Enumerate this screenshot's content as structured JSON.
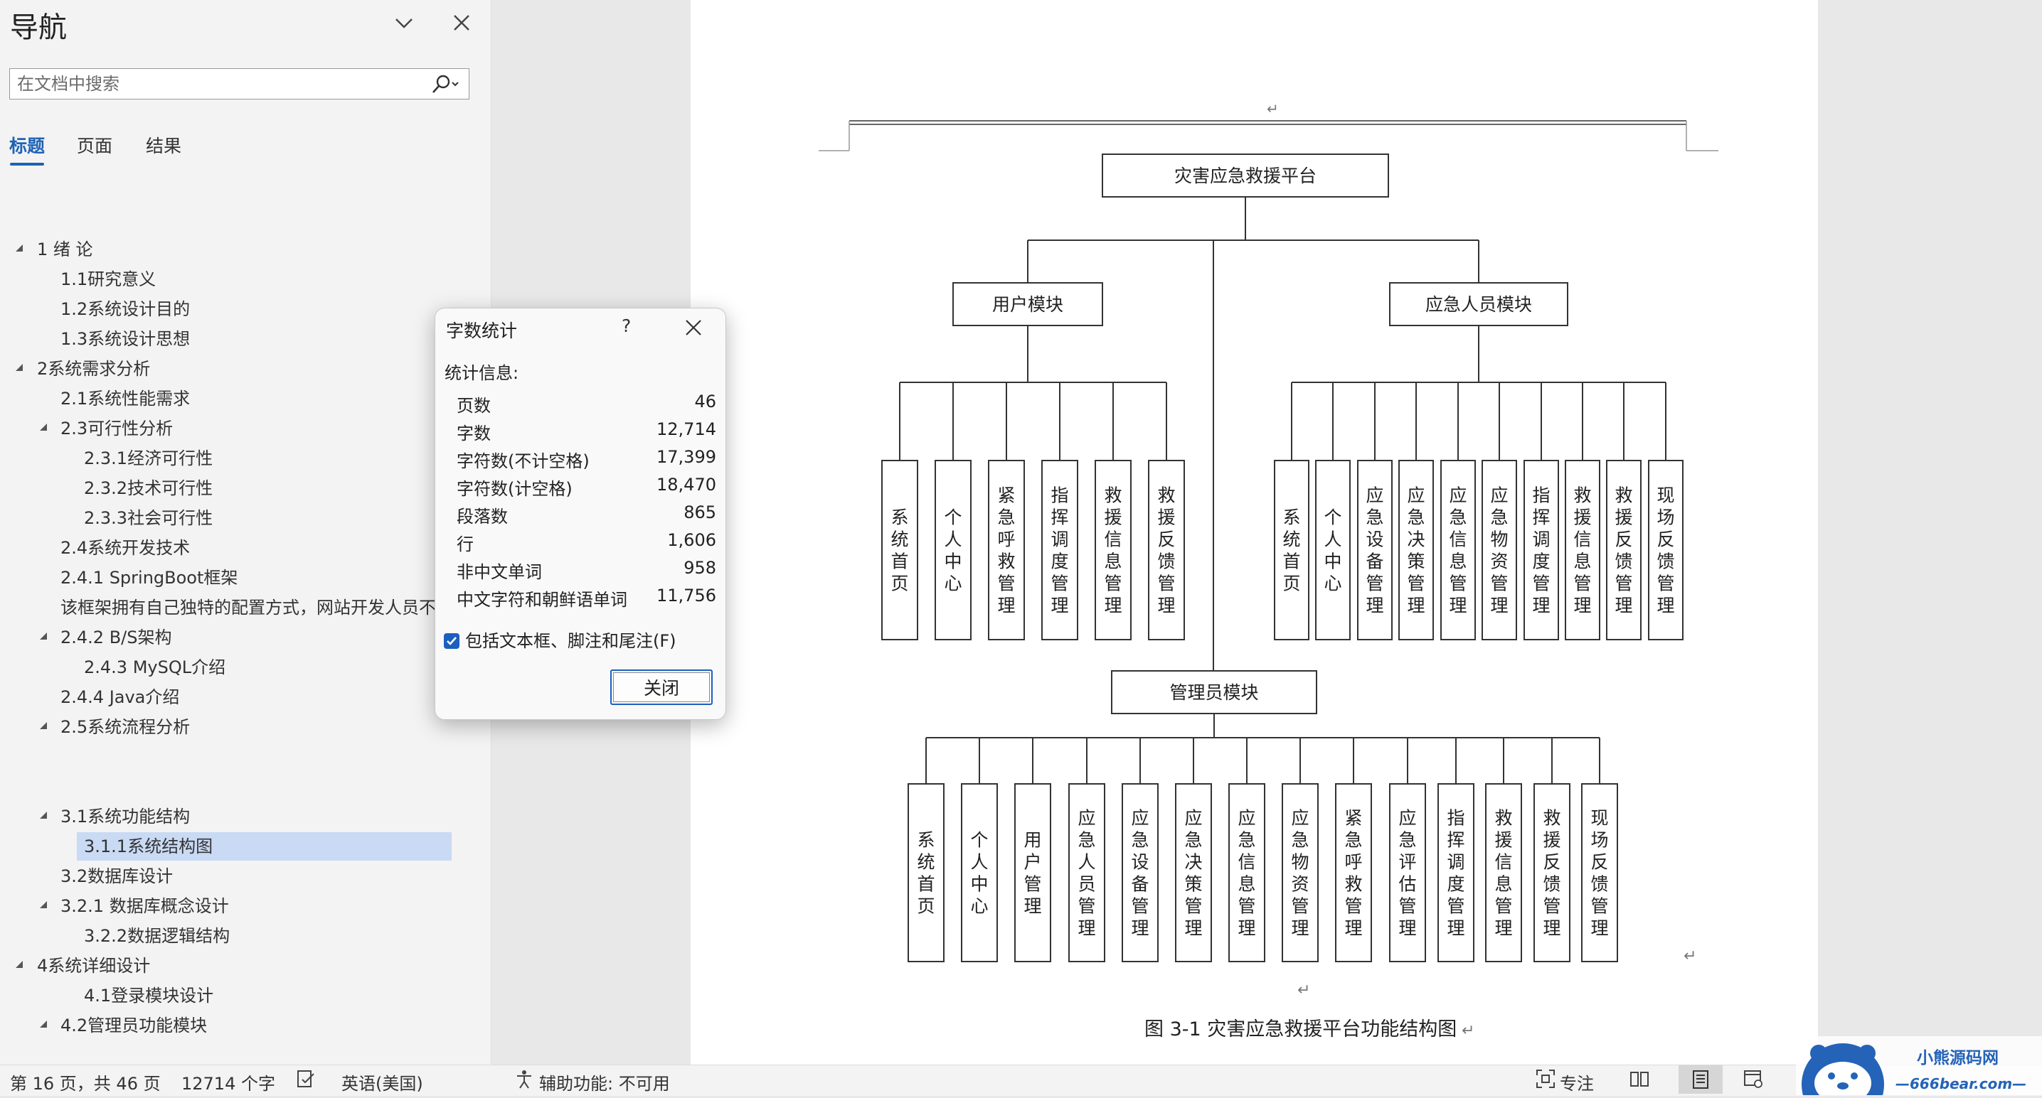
{
  "nav": {
    "title": "导航",
    "search_placeholder": "在文档中搜索",
    "tabs": [
      "标题",
      "页面",
      "结果"
    ],
    "headings": [
      "1 绪  论",
      "1.1研究意义",
      "1.2系统设计目的",
      "1.3系统设计思想",
      "2系统需求分析",
      "2.1系统性能需求",
      "2.3可行性分析",
      "2.3.1经济可行性",
      "2.3.2技术可行性",
      "2.3.3社会可行性",
      "2.4系统开发技术",
      "2.4.1 SpringBoot框架",
      "该框架拥有自己独特的配置方式，网站开发人员不",
      "2.4.2 B/S架构",
      "2.4.3 MySQL介绍",
      "2.4.4 Java介绍",
      "2.5系统流程分析",
      "3.1系统功能结构",
      "3.1.1系统结构图",
      "3.2数据库设计",
      "3.2.1 数据库概念设计",
      "3.2.2数据逻辑结构",
      "4系统详细设计",
      "4.1登录模块设计",
      "4.2管理员功能模块"
    ]
  },
  "dialog": {
    "title": "字数统计",
    "help": "?",
    "section": "统计信息:",
    "stats": [
      {
        "label": "页数",
        "value": "46"
      },
      {
        "label": "字数",
        "value": "12,714"
      },
      {
        "label": "字符数(不计空格)",
        "value": "17,399"
      },
      {
        "label": "字符数(计空格)",
        "value": "18,470"
      },
      {
        "label": "段落数",
        "value": "865"
      },
      {
        "label": "行",
        "value": "1,606"
      },
      {
        "label": "非中文单词",
        "value": "958"
      },
      {
        "label": "中文字符和朝鲜语单词",
        "value": "11,756"
      }
    ],
    "checkbox_label": "包括文本框、脚注和尾注(F)",
    "close_button": "关闭"
  },
  "diagram": {
    "root": "灾害应急救援平台",
    "user_module": {
      "title": "用户模块",
      "leaves": [
        "系统首页",
        "个人中心",
        "紧急呼救管理",
        "指挥调度管理",
        "救援信息管理",
        "救援反馈管理"
      ]
    },
    "responder_module": {
      "title": "应急人员模块",
      "leaves": [
        "系统首页",
        "个人中心",
        "应急设备管理",
        "应急决策管理",
        "应急信息管理",
        "应急物资管理",
        "指挥调度管理",
        "救援信息管理",
        "救援反馈管理",
        "现场反馈管理"
      ]
    },
    "admin_module": {
      "title": "管理员模块",
      "leaves": [
        "系统首页",
        "个人中心",
        "用户管理",
        "应急人员管理",
        "应急设备管理",
        "应急决策管理",
        "应急信息管理",
        "应急物资管理",
        "紧急呼救管理",
        "应急评估管理",
        "指挥调度管理",
        "救援信息管理",
        "救援反馈管理",
        "现场反馈管理"
      ]
    },
    "caption": "图 3-1  灾害应急救援平台功能结构图",
    "return_mark": "↵"
  },
  "statusbar": {
    "page": "第 16 页，共 46 页",
    "words": "12714 个字",
    "language": "英语(美国)",
    "accessibility": "辅助功能: 不可用",
    "focus": "专注"
  },
  "logo": {
    "name": "小熊源码网",
    "url": "—666bear.com—"
  }
}
